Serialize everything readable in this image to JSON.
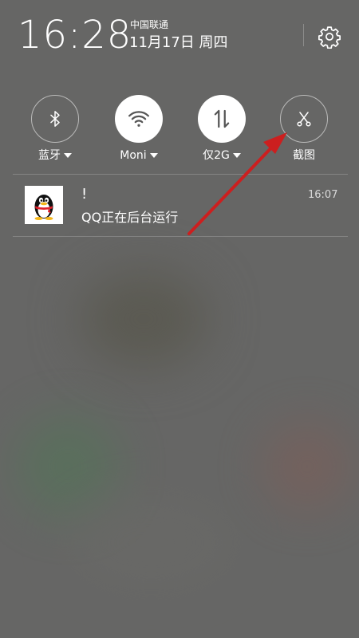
{
  "status": {
    "time": "16:28",
    "carrier": "中国联通",
    "date": "11月17日 周四"
  },
  "quick_toggles": [
    {
      "label": "蓝牙",
      "icon": "bluetooth-icon",
      "state": "off",
      "has_dropdown": true
    },
    {
      "label": "Moni",
      "icon": "wifi-icon",
      "state": "on",
      "has_dropdown": true
    },
    {
      "label": "仅2G",
      "icon": "mobile-data-icon",
      "state": "on",
      "has_dropdown": true
    },
    {
      "label": "截图",
      "icon": "scissors-icon",
      "state": "off",
      "has_dropdown": false
    }
  ],
  "notification": {
    "app_icon": "qq-penguin-icon",
    "title": "!",
    "text": "QQ正在后台运行",
    "time": "16:07"
  },
  "colors": {
    "shade_background": "#666665",
    "annotation_arrow": "#cc1f1f",
    "text": "#ffffff"
  }
}
